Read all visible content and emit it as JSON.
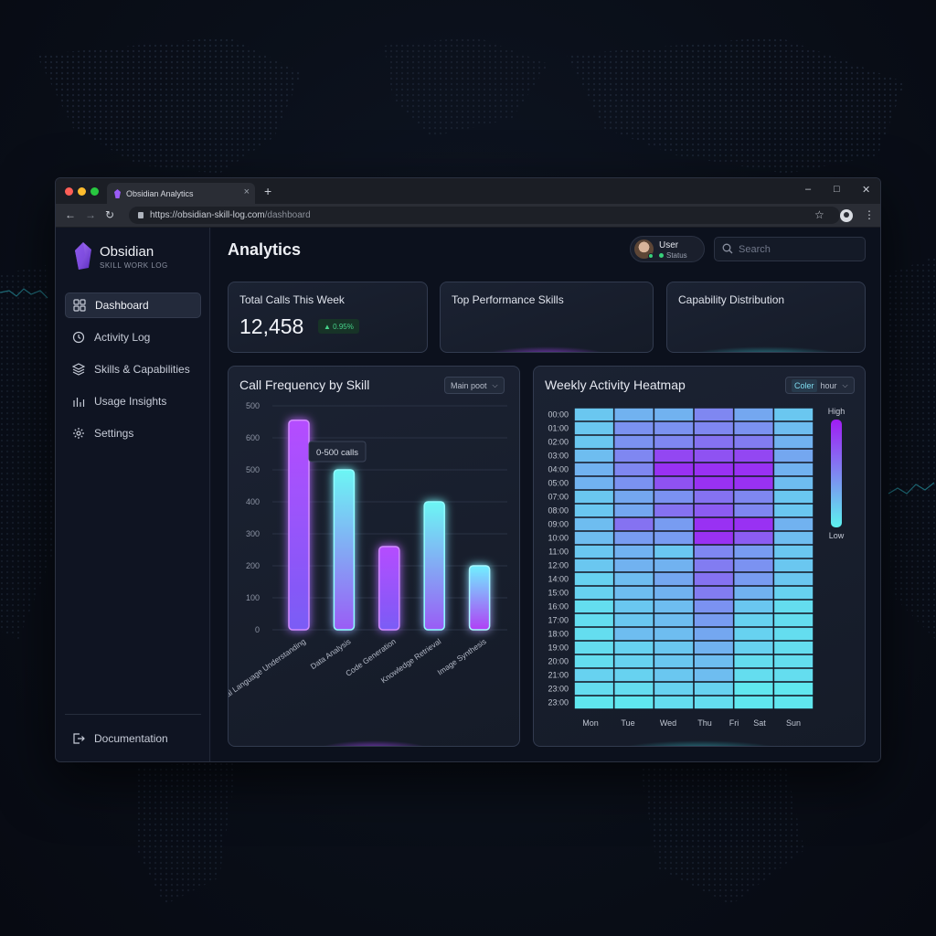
{
  "browser": {
    "tab_title": "Obsidian Analytics",
    "url_host": "https://obsidian-skill-log.com",
    "url_path": "/dashboard"
  },
  "sidebar": {
    "brand": "Obsidian",
    "brand_sub": "SKILL WORK LOG",
    "items": [
      {
        "label": "Dashboard",
        "icon": "grid-icon",
        "active": true
      },
      {
        "label": "Activity Log",
        "icon": "history-icon"
      },
      {
        "label": "Skills & Capabilities",
        "icon": "layers-icon"
      },
      {
        "label": "Usage Insights",
        "icon": "bar-chart-icon"
      },
      {
        "label": "Settings",
        "icon": "gear-icon"
      }
    ],
    "footer_item": {
      "label": "Documentation",
      "icon": "export-icon"
    }
  },
  "header": {
    "title": "Analytics",
    "user_name": "User",
    "user_status": "Status",
    "search_placeholder": "Search"
  },
  "kpis": [
    {
      "title": "Total Calls This Week",
      "value": "12,458",
      "delta": "0.95%"
    },
    {
      "title": "Top Performance Skills"
    },
    {
      "title": "Capability Distribution"
    }
  ],
  "bar_panel": {
    "title": "Call Frequency by Skill",
    "dropdown": "Main poot",
    "tooltip": "0-500 calls"
  },
  "heatmap_panel": {
    "title": "Weekly Activity Heatmap",
    "dropdown_accent": "Coler",
    "dropdown": "hour",
    "legend_high": "High",
    "legend_low": "Low"
  },
  "colors": {
    "purple": "#a53cf5",
    "cyan": "#63f0ee",
    "positive": "#46d28a"
  },
  "chart_data": [
    {
      "type": "bar",
      "title": "Call Frequency by Skill",
      "categories": [
        "Natural Language Understanding",
        "Data Analysis",
        "Code Generation",
        "Knowledge Retrieval",
        "Image Synthesis"
      ],
      "values": [
        655,
        500,
        260,
        400,
        200
      ],
      "y_tick_labels": [
        "500",
        "600",
        "500",
        "400",
        "300",
        "200",
        "100",
        "0"
      ],
      "ylim": [
        0,
        700
      ],
      "grid": true,
      "gradients": [
        "purple",
        "cyan",
        "purple",
        "cyan",
        "cyan-to-purple"
      ]
    },
    {
      "type": "heatmap",
      "title": "Weekly Activity Heatmap",
      "x_labels": [
        "Mon",
        "Tue",
        "Wed",
        "Thu",
        "Fri",
        "Sat",
        "Sun"
      ],
      "y_labels": [
        "00:00",
        "01:00",
        "02:00",
        "03:00",
        "04:00",
        "05:00",
        "07:00",
        "08:00",
        "09:00",
        "10:00",
        "11:00",
        "12:00",
        "14:00",
        "15:00",
        "16:00",
        "17:00",
        "18:00",
        "19:00",
        "20:00",
        "21:00",
        "23:00",
        "23:00"
      ],
      "values": [
        [
          0.2,
          0.3,
          0.3,
          0.5,
          0.35,
          0.2
        ],
        [
          0.2,
          0.45,
          0.45,
          0.5,
          0.45,
          0.25
        ],
        [
          0.2,
          0.45,
          0.5,
          0.6,
          0.55,
          0.3
        ],
        [
          0.25,
          0.5,
          0.8,
          0.75,
          0.8,
          0.35
        ],
        [
          0.3,
          0.5,
          0.9,
          0.9,
          0.9,
          0.3
        ],
        [
          0.3,
          0.45,
          0.75,
          0.9,
          0.9,
          0.25
        ],
        [
          0.2,
          0.35,
          0.45,
          0.6,
          0.5,
          0.2
        ],
        [
          0.2,
          0.35,
          0.6,
          0.7,
          0.5,
          0.2
        ],
        [
          0.25,
          0.6,
          0.4,
          0.9,
          0.9,
          0.3
        ],
        [
          0.25,
          0.4,
          0.4,
          0.9,
          0.7,
          0.25
        ],
        [
          0.2,
          0.3,
          0.2,
          0.5,
          0.4,
          0.2
        ],
        [
          0.2,
          0.3,
          0.3,
          0.55,
          0.45,
          0.2
        ],
        [
          0.15,
          0.25,
          0.35,
          0.6,
          0.4,
          0.2
        ],
        [
          0.15,
          0.25,
          0.3,
          0.55,
          0.3,
          0.15
        ],
        [
          0.1,
          0.2,
          0.25,
          0.45,
          0.2,
          0.1
        ],
        [
          0.1,
          0.2,
          0.25,
          0.4,
          0.15,
          0.1
        ],
        [
          0.1,
          0.25,
          0.25,
          0.35,
          0.15,
          0.1
        ],
        [
          0.1,
          0.15,
          0.2,
          0.3,
          0.15,
          0.1
        ],
        [
          0.1,
          0.15,
          0.2,
          0.25,
          0.1,
          0.1
        ],
        [
          0.15,
          0.15,
          0.2,
          0.25,
          0.1,
          0.1
        ],
        [
          0.1,
          0.1,
          0.15,
          0.15,
          0.05,
          0.05
        ],
        [
          0.05,
          0.05,
          0.1,
          0.1,
          0.05,
          0.05
        ]
      ],
      "color_scale": [
        "#5df2ef",
        "#a01cf3"
      ],
      "legend": {
        "high": "High",
        "low": "Low",
        "position": "right"
      }
    }
  ]
}
